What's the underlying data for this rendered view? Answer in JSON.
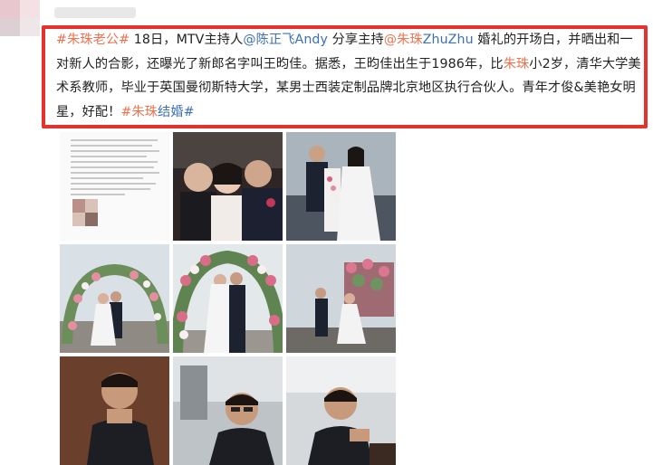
{
  "post": {
    "hashtag_1": "#朱珠老公#",
    "text_1": " 18日，MTV主持人",
    "mention_1": "@陈正飞Andy",
    "text_2": " 分享主持",
    "mention_2_a": "@朱珠",
    "mention_2_b": "ZhuZhu",
    "text_3": " 婚礼的开场白，并晒出和一对新人的合影，还曝光了新郎名字叫王昀佳。据悉，王昀佳出生于1986年，比",
    "name_ref": "朱珠",
    "text_4": "小2岁，清华大学美术系教师，毕业于英国曼彻斯特大学，某男士西装定制品牌北京地区执行合伙人。青年才俊&美艳女明星，好配！",
    "hashtag_2_a": "#朱珠",
    "hashtag_2_b": "结婚#"
  },
  "photos": {
    "watermark": "",
    "items": [
      {
        "name": "photo-text-screenshot"
      },
      {
        "name": "photo-selfie-group"
      },
      {
        "name": "photo-cake-cutting"
      },
      {
        "name": "photo-flower-arch-1"
      },
      {
        "name": "photo-flower-arch-2"
      },
      {
        "name": "photo-flower-arch-3"
      },
      {
        "name": "photo-groom-portrait-1"
      },
      {
        "name": "photo-groom-portrait-2"
      },
      {
        "name": "photo-groom-portrait-3"
      }
    ]
  },
  "colors": {
    "link_orange": "#eb7350",
    "link_blue": "#3c6fb4",
    "highlight_red": "#e5322d"
  }
}
